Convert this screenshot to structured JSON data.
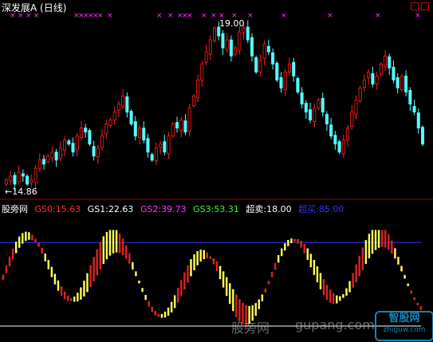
{
  "header": {
    "title": "深发展A (日线)",
    "high_marker": "19.00",
    "low_marker": "←14.86"
  },
  "indicator": {
    "name": "股旁网",
    "items": [
      {
        "label": "GS0:",
        "value": "15.63",
        "color": "#ff3030"
      },
      {
        "label": "GS1:",
        "value": "22.63",
        "color": "#ffffff"
      },
      {
        "label": "GS2:",
        "value": "39.73",
        "color": "#ff33ff"
      },
      {
        "label": "GS3:",
        "value": "53.31",
        "color": "#33ff33"
      },
      {
        "label": "超卖:",
        "value": "18.00",
        "color": "#ffffff"
      },
      {
        "label": "超买:",
        "value": "85.00",
        "color": "#3333ff"
      }
    ]
  },
  "watermark": {
    "left_text": "股旁网",
    "right_text": "gupang.com",
    "logo_text": "智股网",
    "logo_sub": "zhiguw.com"
  },
  "colors": {
    "up": "#ff2020",
    "down": "#55ffff",
    "marker": "#ff33ff",
    "gs0": "#dd2222",
    "gs1": "#ffff55",
    "gs2": "#ff33ff",
    "gs3": "#33ff33",
    "overbuy": "#3333ff",
    "oversell": "#ffffff"
  },
  "chart_data": [
    {
      "type": "candlestick",
      "title": "深发展A (日线)",
      "annotations": [
        "19.00",
        "14.86"
      ],
      "close": [
        15.1,
        15.2,
        15.0,
        15.3,
        15.2,
        15.0,
        15.1,
        15.4,
        15.6,
        15.5,
        15.7,
        15.8,
        15.6,
        15.9,
        16.1,
        16.0,
        15.8,
        16.2,
        16.4,
        16.3,
        16.0,
        15.7,
        15.9,
        16.2,
        16.5,
        16.6,
        16.8,
        17.0,
        17.2,
        16.8,
        16.5,
        16.2,
        16.4,
        16.1,
        15.8,
        15.6,
        15.9,
        16.0,
        15.8,
        16.2,
        16.5,
        16.4,
        16.6,
        16.3,
        16.9,
        17.2,
        17.6,
        18.0,
        18.3,
        18.6,
        18.9,
        18.7,
        18.4,
        18.6,
        18.2,
        18.4,
        18.8,
        18.9,
        18.6,
        18.2,
        17.8,
        18.1,
        18.5,
        18.3,
        18.0,
        17.6,
        17.4,
        17.8,
        18.0,
        17.7,
        17.3,
        17.0,
        16.8,
        16.6,
        16.9,
        17.1,
        16.8,
        16.5,
        16.2,
        16.0,
        15.8,
        16.1,
        16.4,
        16.8,
        17.1,
        17.4,
        17.6,
        17.8,
        17.5,
        17.7,
        18.0,
        18.2,
        17.9,
        17.6,
        17.4,
        17.7,
        17.3,
        17.0,
        16.8,
        16.4,
        16.0
      ]
    },
    {
      "type": "bar",
      "title": "股旁网",
      "series": [
        {
          "name": "GS0",
          "last": 15.63
        },
        {
          "name": "GS1",
          "last": 22.63
        },
        {
          "name": "GS2",
          "last": 39.73
        },
        {
          "name": "GS3",
          "last": 53.31
        }
      ],
      "levels": {
        "超卖": 18.0,
        "超买": 85.0
      }
    }
  ]
}
